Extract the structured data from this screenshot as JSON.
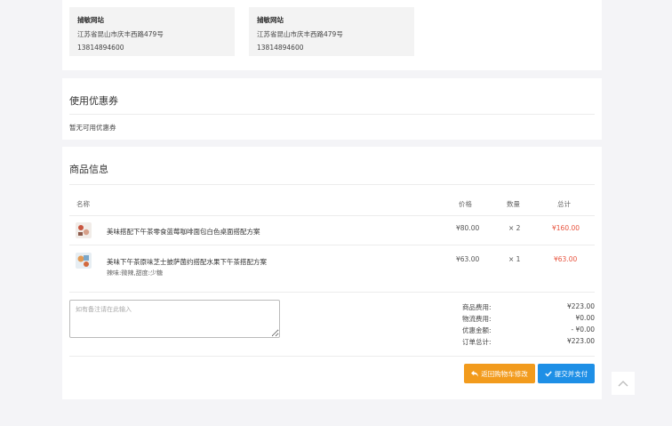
{
  "addresses": [
    {
      "name": "捕敏网站",
      "address": "江苏省昆山市庆丰西路479号",
      "phone": "13814894600"
    },
    {
      "name": "捕敏网站",
      "address": "江苏省昆山市庆丰西路479号",
      "phone": "13814894600"
    }
  ],
  "coupon": {
    "title": "使用优惠券",
    "empty_text": "暂无可用优惠券"
  },
  "goods": {
    "title": "商品信息",
    "headers": {
      "name": "名称",
      "price": "价格",
      "qty": "数量",
      "total": "总计"
    },
    "items": [
      {
        "name": "美味搭配下午茶零食蓝莓咖啡面包白色桌面搭配方案",
        "attr": "",
        "price": "¥80.00",
        "qty": "× 2",
        "total": "¥160.00"
      },
      {
        "name": "美味下午茶原味芝士披萨菌约搭配水果下午茶搭配方案",
        "attr": "辣味:微辣,甜度:少糖",
        "price": "¥63.00",
        "qty": "× 1",
        "total": "¥63.00"
      }
    ]
  },
  "remark": {
    "placeholder": "如有备注请在此输入"
  },
  "summary": [
    {
      "label": "商品费用:",
      "value": "¥223.00"
    },
    {
      "label": "物流费用:",
      "value": "¥0.00"
    },
    {
      "label": "优惠金额:",
      "value": "- ¥0.00"
    },
    {
      "label": "订单总计:",
      "value": "¥223.00"
    }
  ],
  "buttons": {
    "back": "返回购物车修改",
    "submit": "提交并支付"
  },
  "icons": {
    "back": "reply-icon",
    "submit": "check-icon",
    "top": "chevron-up-icon"
  },
  "colors": {
    "accent_red": "#e8543f",
    "back_btn": "#f29b1d",
    "submit_btn": "#1e8fe6"
  }
}
